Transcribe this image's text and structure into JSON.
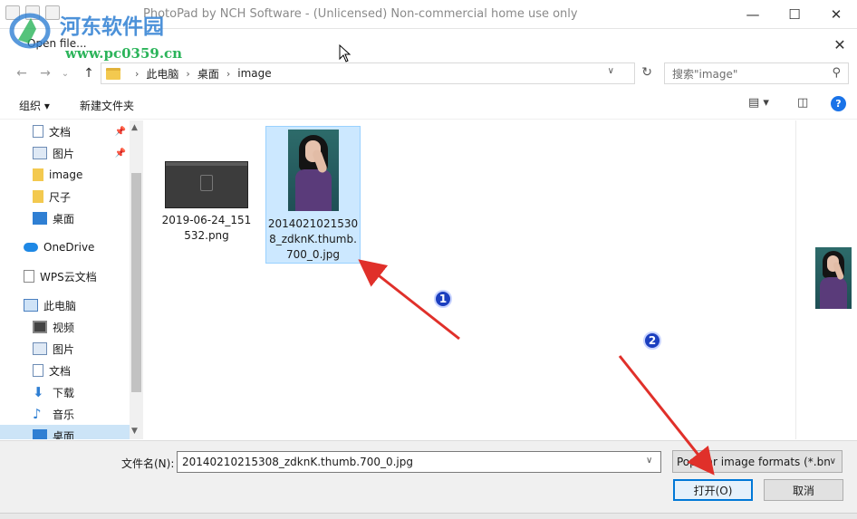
{
  "app": {
    "title": "PhotoPad by NCH Software - (Unlicensed) Non-commercial home use only",
    "minimize": "—",
    "maximize": "☐",
    "close": "✕"
  },
  "watermark": {
    "title": "河东软件园",
    "url": "www.pc0359.cn"
  },
  "dialog": {
    "title": "Open file...",
    "close": "✕"
  },
  "nav": {
    "back": "←",
    "forward": "→",
    "recent": "⌄",
    "up": "↑",
    "path": [
      "此电脑",
      "桌面",
      "image"
    ],
    "separator": "›",
    "refresh": "↻",
    "search_placeholder": "搜索\"image\""
  },
  "toolbar": {
    "organize": "组织 ▾",
    "new_folder": "新建文件夹",
    "view_icon": "▤ ▾",
    "pane_icon": "◫",
    "help": "?"
  },
  "sidebar": {
    "items": [
      {
        "label": "文档",
        "icon": "document-icon",
        "pinned": true
      },
      {
        "label": "图片",
        "icon": "pictures-icon",
        "pinned": true
      },
      {
        "label": "image",
        "icon": "folder-icon",
        "pinned": false
      },
      {
        "label": "尺子",
        "icon": "folder-icon",
        "pinned": false
      },
      {
        "label": "桌面",
        "icon": "desktop-icon",
        "pinned": false
      },
      {
        "label": "OneDrive",
        "icon": "onedrive-icon",
        "pinned": false
      },
      {
        "label": "WPS云文档",
        "icon": "wps-cloud-icon",
        "pinned": false
      },
      {
        "label": "此电脑",
        "icon": "computer-icon",
        "pinned": false
      },
      {
        "label": "视频",
        "icon": "video-icon",
        "pinned": false
      },
      {
        "label": "图片",
        "icon": "pictures-icon",
        "pinned": false
      },
      {
        "label": "文档",
        "icon": "document-icon",
        "pinned": false
      },
      {
        "label": "下载",
        "icon": "download-icon",
        "pinned": false
      },
      {
        "label": "音乐",
        "icon": "music-icon",
        "pinned": false
      },
      {
        "label": "桌面",
        "icon": "desktop-icon",
        "pinned": false
      }
    ],
    "pin_glyph": "📌"
  },
  "files": [
    {
      "name": "2019-06-24_151532.png",
      "lines": [
        "2019-06-24_151",
        "532.png"
      ],
      "selected": false
    },
    {
      "name": "20140210215308_zdknK.thumb.700_0.jpg",
      "lines": [
        "2014021021530",
        "8_zdknK.thumb.",
        "700_0.jpg"
      ],
      "selected": true
    }
  ],
  "bottom": {
    "filename_label": "文件名(N):",
    "filename_value": "20140210215308_zdknK.thumb.700_0.jpg",
    "filter": "Popular image formats (*.bn",
    "open_button": "打开(O)",
    "cancel_button": "取消"
  },
  "annotations": {
    "badges": [
      "1",
      "2"
    ],
    "arrow_color": "#e0302a"
  }
}
